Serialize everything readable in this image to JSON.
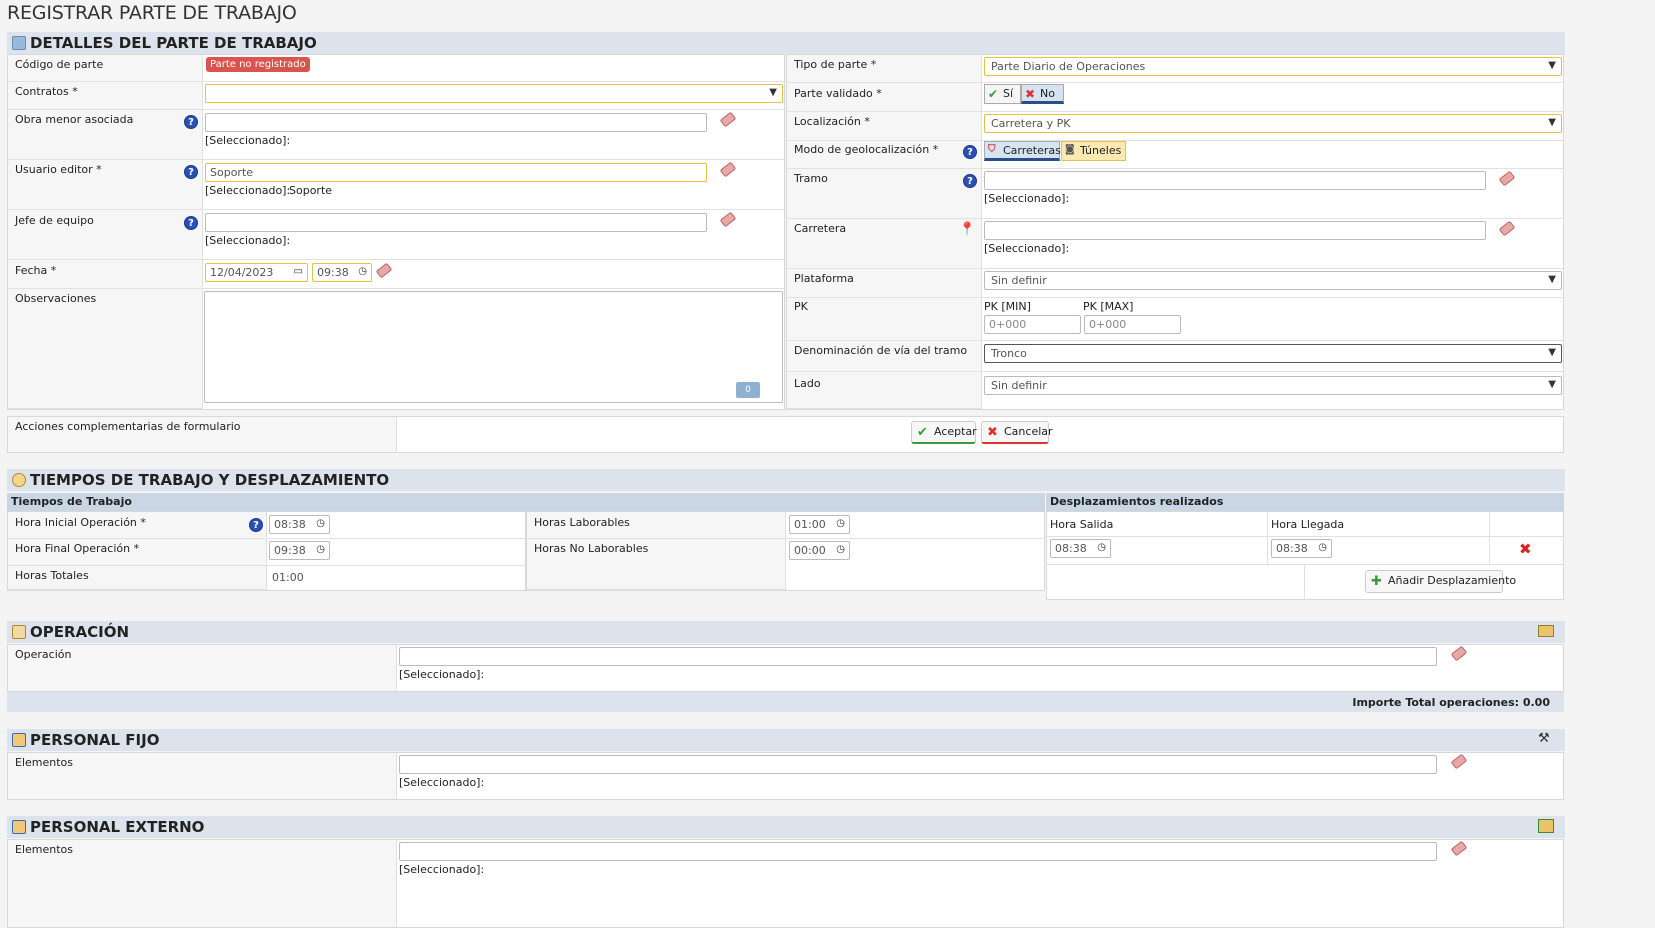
{
  "page_title": "REGISTRAR PARTE DE TRABAJO",
  "detalles": {
    "title": "DETALLES DEL PARTE DE TRABAJO",
    "codigo_label": "Código de parte",
    "codigo_badge": "Parte no registrado",
    "contratos_label": "Contratos *",
    "obra_label": "Obra menor asociada",
    "usuario_label": "Usuario editor *",
    "usuario_value": "Soporte",
    "usuario_selected": "Soporte",
    "jefe_label": "Jefe de equipo",
    "selected_label": "[Seleccionado]:",
    "fecha_label": "Fecha *",
    "fecha_value": "12/04/2023",
    "hora_value": "09:38",
    "observaciones_label": "Observaciones",
    "obs_counter": "0",
    "tipo_label": "Tipo de parte *",
    "tipo_value": "Parte Diario de Operaciones",
    "validado_label": "Parte validado *",
    "si_label": "Sí",
    "no_label": "No",
    "localizacion_label": "Localización *",
    "localizacion_value": "Carretera y PK",
    "geoloc_label": "Modo de geolocalización *",
    "carreteras_label": "Carreteras",
    "tuneles_label": "Túneles",
    "tramo_label": "Tramo",
    "carretera_label": "Carretera",
    "plataforma_label": "Plataforma",
    "plataforma_value": "Sin definir",
    "pk_label": "PK",
    "pk_min_label": "PK [MIN]",
    "pk_max_label": "PK [MAX]",
    "pk_min_placeholder": "0+000",
    "pk_max_placeholder": "0+000",
    "denominacion_label": "Denominación de vía del tramo",
    "denominacion_value": "Tronco",
    "lado_label": "Lado",
    "lado_value": "Sin definir",
    "acciones_label": "Acciones complementarias de formulario",
    "aceptar": "Aceptar",
    "cancelar": "Cancelar"
  },
  "tiempos": {
    "title": "TIEMPOS DE TRABAJO Y DESPLAZAMIENTO",
    "sub_trabajo": "Tiempos de Trabajo",
    "hora_inicial_label": "Hora Inicial Operación *",
    "hora_inicial": "08:38",
    "hora_final_label": "Hora Final Operación *",
    "hora_final": "09:38",
    "horas_totales_label": "Horas Totales",
    "horas_totales": "01:00",
    "laborables_label": "Horas Laborables",
    "laborables": "01:00",
    "no_laborables_label": "Horas No Laborables",
    "no_laborables": "00:00",
    "sub_desplaz": "Desplazamientos realizados",
    "hora_salida_label": "Hora Salida",
    "hora_llegada_label": "Hora Llegada",
    "salida": "08:38",
    "llegada": "08:38",
    "anadir": "Añadir Desplazamiento"
  },
  "operacion": {
    "title": "OPERACIÓN",
    "label": "Operación",
    "selected_label": "[Seleccionado]:",
    "importe": "Importe Total operaciones: 0.00"
  },
  "personal_fijo": {
    "title": "PERSONAL FIJO",
    "label": "Elementos",
    "selected_label": "[Seleccionado]:"
  },
  "personal_externo": {
    "title": "PERSONAL EXTERNO",
    "label": "Elementos",
    "selected_label": "[Seleccionado]:"
  },
  "colors": {
    "section_bg": "#dce3ec",
    "error_red": "#d9534f",
    "help_blue": "#2a50b4",
    "required_yellow": "#e6c248"
  }
}
